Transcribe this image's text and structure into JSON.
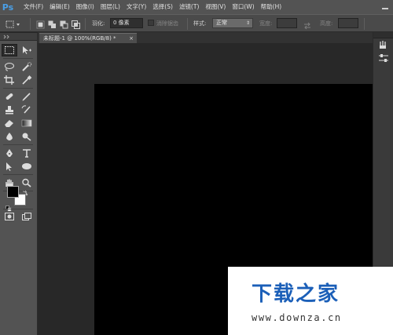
{
  "app": {
    "logo": "Ps",
    "menus": [
      "文件(F)",
      "编辑(E)",
      "图像(I)",
      "图层(L)",
      "文字(Y)",
      "选择(S)",
      "滤镜(T)",
      "视图(V)",
      "窗口(W)",
      "帮助(H)"
    ]
  },
  "options_bar": {
    "tool_preset_icon": "marquee-rect-icon",
    "feather_label": "羽化:",
    "feather_value": "0 像素",
    "antialias_label": "消除锯齿",
    "style_label": "样式:",
    "style_value": "正常",
    "width_label": "宽度:",
    "width_value": "",
    "height_label": "高度:",
    "height_value": ""
  },
  "document": {
    "tab_title": "未标题-1 @ 100%(RGB/8) *",
    "tab_close": "×",
    "canvas_color": "#000000"
  },
  "tools": {
    "items": [
      "rect-marquee",
      "move",
      "lasso",
      "quick-selection",
      "crop",
      "eyedropper",
      "spot-healing",
      "brush",
      "clone-stamp",
      "history-brush",
      "eraser",
      "gradient",
      "blur",
      "dodge",
      "pen",
      "type",
      "path-selection",
      "ellipse",
      "hand",
      "zoom"
    ],
    "foreground_color": "#000000",
    "background_color": "#ffffff"
  },
  "right_panel": {
    "icons": [
      "brush-presets-icon",
      "adjust-icon"
    ]
  },
  "watermark": {
    "title": "下载之家",
    "url": "www.downza.cn"
  },
  "colors": {
    "menubar": "#535353",
    "workspace": "#282828",
    "panel": "#535353",
    "ps_blue": "#4a9fe6",
    "watermark_blue": "#1b5fb8"
  }
}
